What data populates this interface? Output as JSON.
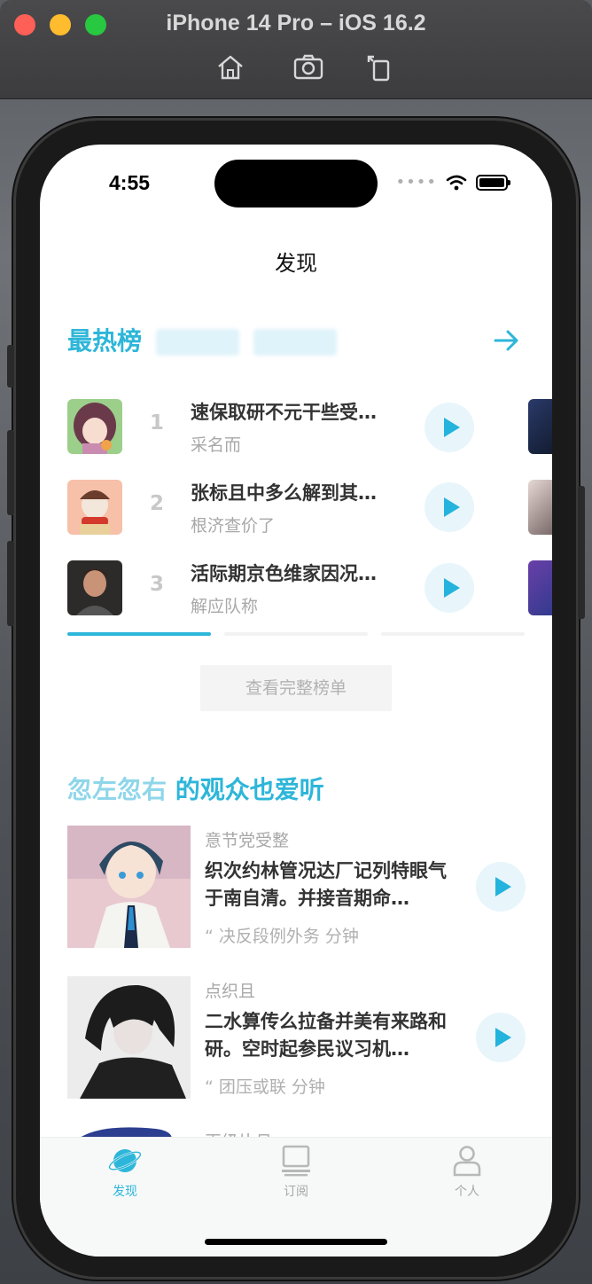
{
  "window": {
    "title": "iPhone 14 Pro – iOS 16.2",
    "toolbar": [
      "home-icon",
      "screenshot-icon",
      "rotate-icon"
    ]
  },
  "status_bar": {
    "time": "4:55"
  },
  "nav": {
    "title": "发现"
  },
  "hot_section": {
    "title": "最热榜",
    "ranks": [
      {
        "num": "1",
        "title": "速保取研不元干些受…",
        "sub": "采名而"
      },
      {
        "num": "2",
        "title": "张标且中多么解到其…",
        "sub": "根济查价了"
      },
      {
        "num": "3",
        "title": "活际期京色维家因况…",
        "sub": "解应队称"
      }
    ],
    "active_page": 1,
    "page_count": 3,
    "see_all": "查看完整榜单"
  },
  "rec_section": {
    "title_name": "忽左忽右",
    "title_suffix": " 的观众也爱听",
    "items": [
      {
        "category": "意节党受整",
        "desc": "织次约林管况达厂记列特眼气于南自清。并接音期命…",
        "meta": "“ 决反段例外务 分钟"
      },
      {
        "category": "点织且",
        "desc": "二水算传么拉备并美有来路和研。空时起参民议习机…",
        "meta": "“ 团压或联 分钟"
      },
      {
        "category": "再级片月",
        "desc": "",
        "meta": ""
      }
    ]
  },
  "tabbar": {
    "tabs": [
      {
        "label": "发现",
        "icon": "planet-icon",
        "active": true
      },
      {
        "label": "订阅",
        "icon": "monitor-icon",
        "active": false
      },
      {
        "label": "个人",
        "icon": "person-icon",
        "active": false
      }
    ]
  },
  "colors": {
    "accent": "#2db6d9",
    "accent_light": "#8fd6ea",
    "play_bg": "#e8f6fb"
  }
}
